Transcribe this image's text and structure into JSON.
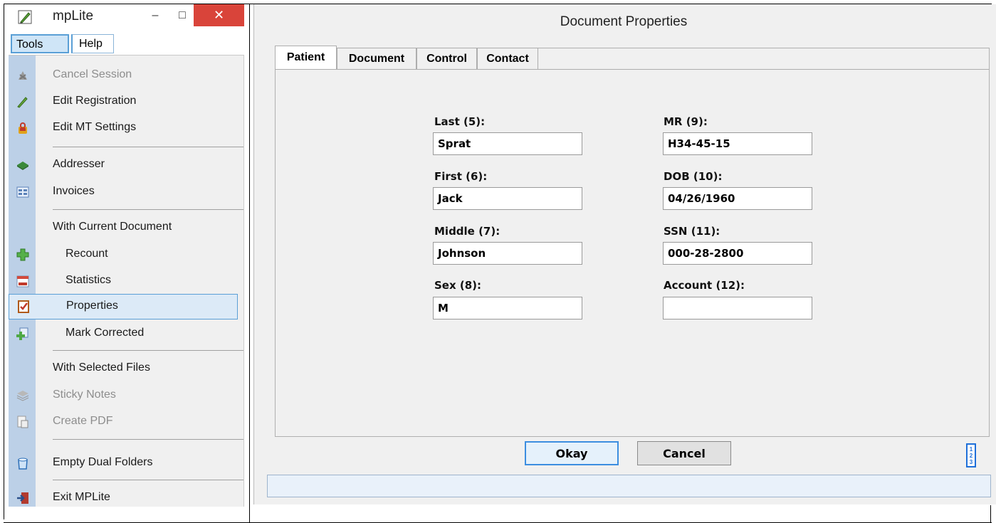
{
  "window": {
    "title": "mpLite",
    "close_glyph": "✕",
    "min_glyph": "–",
    "max_glyph": "□"
  },
  "menubar": {
    "tools": "Tools",
    "help": "Help"
  },
  "menu": {
    "items": [
      {
        "label": "Cancel Session",
        "icon": "cancel-session-icon",
        "disabled": true
      },
      {
        "label": "Edit Registration",
        "icon": "pencil-icon"
      },
      {
        "label": "Edit MT Settings",
        "icon": "settings-lock-icon"
      },
      {
        "label": "Addresser",
        "icon": "addresser-icon"
      },
      {
        "label": "Invoices",
        "icon": "invoices-icon"
      },
      {
        "label": "With Current Document",
        "header": true
      },
      {
        "label": "Recount",
        "icon": "recount-plus-icon"
      },
      {
        "label": "Statistics",
        "icon": "statistics-icon"
      },
      {
        "label": "Properties",
        "icon": "properties-icon",
        "selected": true
      },
      {
        "label": "Mark Corrected",
        "icon": "mark-corrected-icon"
      },
      {
        "label": "With Selected Files",
        "header": true
      },
      {
        "label": "Sticky Notes",
        "icon": "sticky-notes-icon",
        "disabled": true
      },
      {
        "label": "Create PDF",
        "icon": "create-pdf-icon",
        "disabled": true
      },
      {
        "label": "Empty Dual Folders",
        "icon": "empty-folders-icon"
      },
      {
        "label": "Exit MPLite",
        "icon": "exit-icon"
      }
    ]
  },
  "dialog": {
    "title": "Document Properties",
    "tabs": [
      "Patient",
      "Document",
      "Control",
      "Contact"
    ],
    "active_tab": "Patient",
    "fields": {
      "last": {
        "label": "Last (5):",
        "value": "Sprat"
      },
      "first": {
        "label": "First (6):",
        "value": "Jack"
      },
      "middle": {
        "label": "Middle (7):",
        "value": "Johnson"
      },
      "sex": {
        "label": "Sex (8):",
        "value": "M"
      },
      "mr": {
        "label": "MR (9):",
        "value": "H34-45-15"
      },
      "dob": {
        "label": "DOB (10):",
        "value": "04/26/1960"
      },
      "ssn": {
        "label": "SSN (11):",
        "value": "000-28-2800"
      },
      "account": {
        "label": "Account (12):",
        "value": ""
      }
    },
    "buttons": {
      "okay": "Okay",
      "cancel": "Cancel"
    },
    "help_icon_text": "1\n2\n3"
  },
  "colors": {
    "close_button": "#d9443a",
    "menu_gutter": "#bcd0e7",
    "selection": "#dceaf7",
    "accent": "#3c8ee0"
  }
}
